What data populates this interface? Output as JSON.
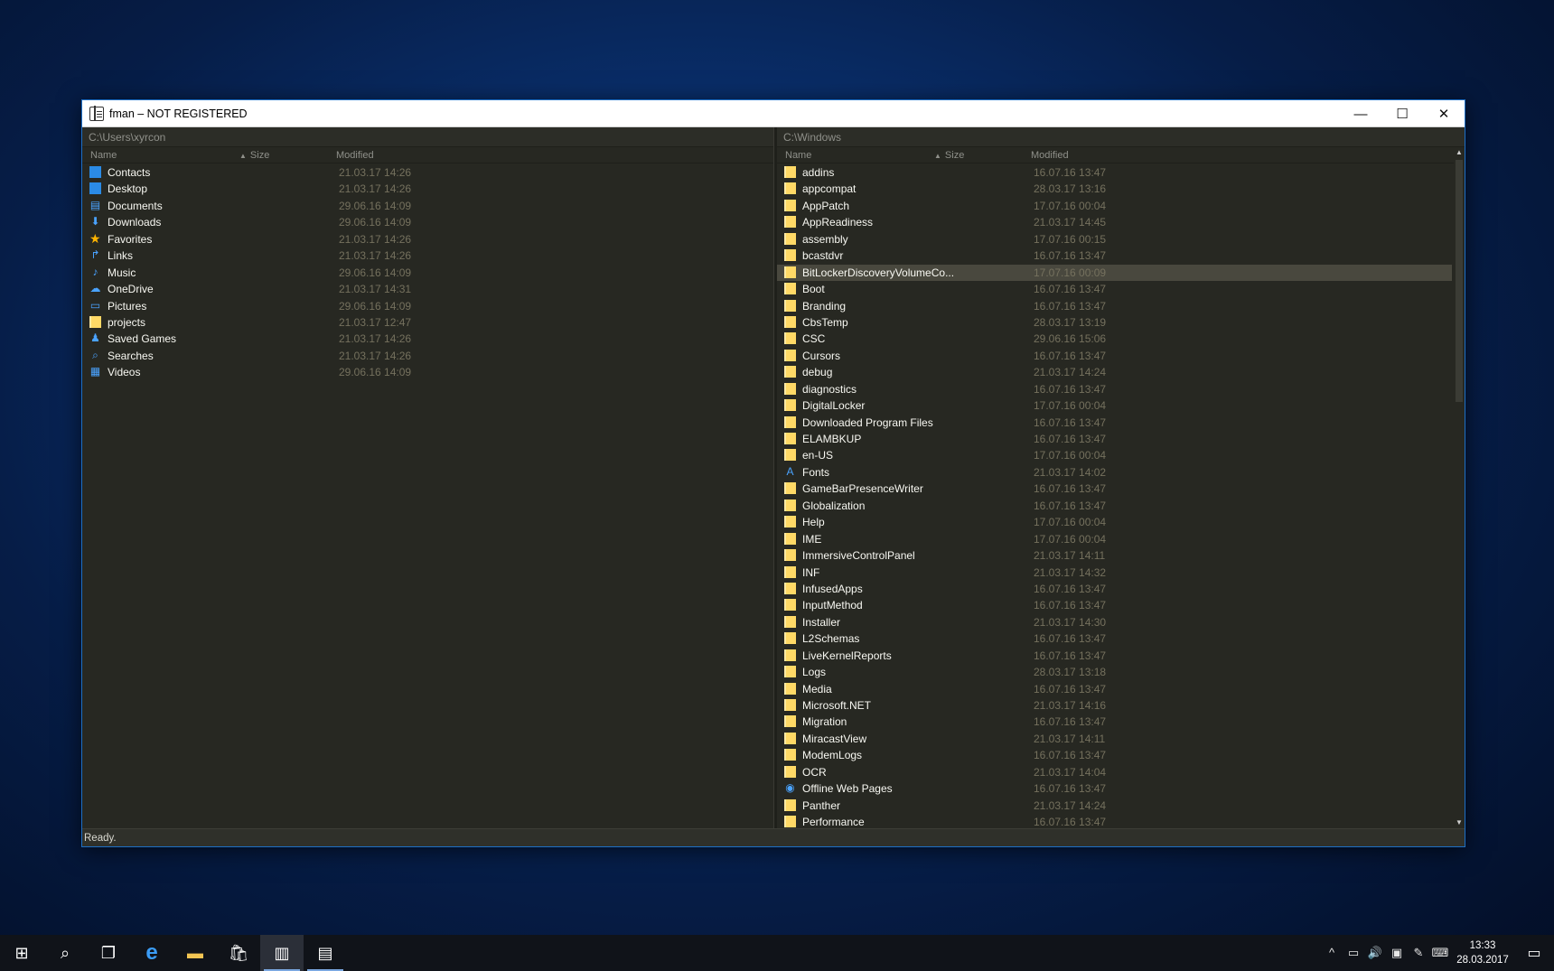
{
  "window": {
    "title": "fman – NOT REGISTERED",
    "minimize": "—",
    "maximize": "☐",
    "close": "✕"
  },
  "left_pane": {
    "path": "C:\\Users\\xyrcon",
    "col_name": "Name",
    "col_size": "Size",
    "col_modified": "Modified",
    "rows": [
      {
        "name": "Contacts",
        "modified": "21.03.17 14:26",
        "icon": "contacts-icon"
      },
      {
        "name": "Desktop",
        "modified": "21.03.17 14:26",
        "icon": "desktop-icon"
      },
      {
        "name": "Documents",
        "modified": "29.06.16 14:09",
        "icon": "documents-icon"
      },
      {
        "name": "Downloads",
        "modified": "29.06.16 14:09",
        "icon": "downloads-icon"
      },
      {
        "name": "Favorites",
        "modified": "21.03.17 14:26",
        "icon": "star-icon"
      },
      {
        "name": "Links",
        "modified": "21.03.17 14:26",
        "icon": "link-icon"
      },
      {
        "name": "Music",
        "modified": "29.06.16 14:09",
        "icon": "music-icon"
      },
      {
        "name": "OneDrive",
        "modified": "21.03.17 14:31",
        "icon": "cloud-icon"
      },
      {
        "name": "Pictures",
        "modified": "29.06.16 14:09",
        "icon": "pictures-icon"
      },
      {
        "name": "projects",
        "modified": "21.03.17 12:47",
        "icon": "folder-icon"
      },
      {
        "name": "Saved Games",
        "modified": "21.03.17 14:26",
        "icon": "saved-games-icon"
      },
      {
        "name": "Searches",
        "modified": "21.03.17 14:26",
        "icon": "search-icon"
      },
      {
        "name": "Videos",
        "modified": "29.06.16 14:09",
        "icon": "videos-icon"
      }
    ]
  },
  "right_pane": {
    "path": "C:\\Windows",
    "col_name": "Name",
    "col_size": "Size",
    "col_modified": "Modified",
    "rows": [
      {
        "name": "addins",
        "modified": "16.07.16 13:47",
        "icon": "folder-icon"
      },
      {
        "name": "appcompat",
        "modified": "28.03.17 13:16",
        "icon": "folder-icon"
      },
      {
        "name": "AppPatch",
        "modified": "17.07.16 00:04",
        "icon": "folder-icon"
      },
      {
        "name": "AppReadiness",
        "modified": "21.03.17 14:45",
        "icon": "folder-icon"
      },
      {
        "name": "assembly",
        "modified": "17.07.16 00:15",
        "icon": "folder-icon"
      },
      {
        "name": "bcastdvr",
        "modified": "16.07.16 13:47",
        "icon": "folder-icon"
      },
      {
        "name": "BitLockerDiscoveryVolumeCo...",
        "modified": "17.07.16 00:09",
        "icon": "folder-icon",
        "selected": true
      },
      {
        "name": "Boot",
        "modified": "16.07.16 13:47",
        "icon": "folder-icon"
      },
      {
        "name": "Branding",
        "modified": "16.07.16 13:47",
        "icon": "folder-icon"
      },
      {
        "name": "CbsTemp",
        "modified": "28.03.17 13:19",
        "icon": "folder-icon"
      },
      {
        "name": "CSC",
        "modified": "29.06.16 15:06",
        "icon": "folder-icon"
      },
      {
        "name": "Cursors",
        "modified": "16.07.16 13:47",
        "icon": "folder-icon"
      },
      {
        "name": "debug",
        "modified": "21.03.17 14:24",
        "icon": "folder-icon"
      },
      {
        "name": "diagnostics",
        "modified": "16.07.16 13:47",
        "icon": "folder-icon"
      },
      {
        "name": "DigitalLocker",
        "modified": "17.07.16 00:04",
        "icon": "folder-icon"
      },
      {
        "name": "Downloaded Program Files",
        "modified": "16.07.16 13:47",
        "icon": "folder-icon"
      },
      {
        "name": "ELAMBKUP",
        "modified": "16.07.16 13:47",
        "icon": "folder-icon"
      },
      {
        "name": "en-US",
        "modified": "17.07.16 00:04",
        "icon": "folder-icon"
      },
      {
        "name": "Fonts",
        "modified": "21.03.17 14:02",
        "icon": "fonts-icon"
      },
      {
        "name": "GameBarPresenceWriter",
        "modified": "16.07.16 13:47",
        "icon": "folder-icon"
      },
      {
        "name": "Globalization",
        "modified": "16.07.16 13:47",
        "icon": "folder-icon"
      },
      {
        "name": "Help",
        "modified": "17.07.16 00:04",
        "icon": "folder-icon"
      },
      {
        "name": "IME",
        "modified": "17.07.16 00:04",
        "icon": "folder-icon"
      },
      {
        "name": "ImmersiveControlPanel",
        "modified": "21.03.17 14:11",
        "icon": "folder-icon"
      },
      {
        "name": "INF",
        "modified": "21.03.17 14:32",
        "icon": "folder-icon"
      },
      {
        "name": "InfusedApps",
        "modified": "16.07.16 13:47",
        "icon": "folder-icon"
      },
      {
        "name": "InputMethod",
        "modified": "16.07.16 13:47",
        "icon": "folder-icon"
      },
      {
        "name": "Installer",
        "modified": "21.03.17 14:30",
        "icon": "folder-icon"
      },
      {
        "name": "L2Schemas",
        "modified": "16.07.16 13:47",
        "icon": "folder-icon"
      },
      {
        "name": "LiveKernelReports",
        "modified": "16.07.16 13:47",
        "icon": "folder-icon"
      },
      {
        "name": "Logs",
        "modified": "28.03.17 13:18",
        "icon": "folder-icon"
      },
      {
        "name": "Media",
        "modified": "16.07.16 13:47",
        "icon": "folder-icon"
      },
      {
        "name": "Microsoft.NET",
        "modified": "21.03.17 14:16",
        "icon": "folder-icon"
      },
      {
        "name": "Migration",
        "modified": "16.07.16 13:47",
        "icon": "folder-icon"
      },
      {
        "name": "MiracastView",
        "modified": "21.03.17 14:11",
        "icon": "folder-icon"
      },
      {
        "name": "ModemLogs",
        "modified": "16.07.16 13:47",
        "icon": "folder-icon"
      },
      {
        "name": "OCR",
        "modified": "21.03.17 14:04",
        "icon": "folder-icon"
      },
      {
        "name": "Offline Web Pages",
        "modified": "16.07.16 13:47",
        "icon": "web-pages-icon"
      },
      {
        "name": "Panther",
        "modified": "21.03.17 14:24",
        "icon": "panther-icon"
      },
      {
        "name": "Performance",
        "modified": "16.07.16 13:47",
        "icon": "folder-icon"
      }
    ]
  },
  "status": "Ready.",
  "taskbar": {
    "items": [
      {
        "name": "start-button",
        "glyph": "⊞"
      },
      {
        "name": "search-button",
        "glyph": "⌕"
      },
      {
        "name": "task-view-button",
        "glyph": "❐"
      },
      {
        "name": "edge-browser",
        "glyph": "e"
      },
      {
        "name": "file-explorer",
        "glyph": "▬"
      },
      {
        "name": "store",
        "glyph": "🛍"
      },
      {
        "name": "fman-app",
        "glyph": "▥"
      },
      {
        "name": "app-installer",
        "glyph": "▤"
      }
    ],
    "tray_icons": [
      "^",
      "▭",
      "🔊",
      "▣",
      "✎",
      "⌨"
    ],
    "time": "13:33",
    "date": "28.03.2017",
    "notifications_glyph": "▭"
  },
  "colors": {
    "pane_bg": "#272822",
    "text": "#f8f8f2",
    "date_text": "#75715e",
    "folder": "#ffd966",
    "selected_row": "#49483e"
  }
}
